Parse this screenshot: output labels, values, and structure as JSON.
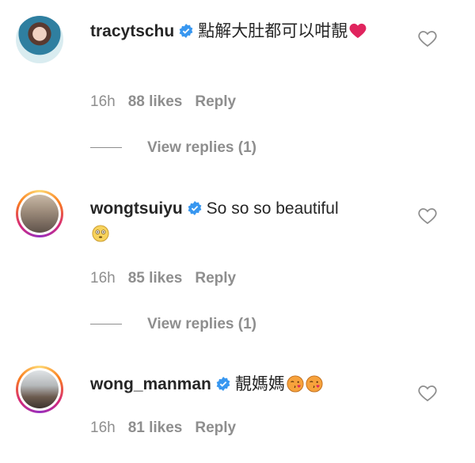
{
  "comments": [
    {
      "username": "tracytschu",
      "verified": true,
      "text": "點解大肚都可以咁靚",
      "emoji": "red-heart",
      "time": "16h",
      "likes": "88 likes",
      "reply": "Reply",
      "view_replies": "View replies (1)"
    },
    {
      "username": "wongtsuiyu",
      "verified": true,
      "text": "So so so beautiful",
      "emoji": "flushed-face",
      "time": "16h",
      "likes": "85 likes",
      "reply": "Reply",
      "view_replies": "View replies (1)"
    },
    {
      "username": "wong_manman",
      "verified": true,
      "text": "靚媽媽",
      "emoji": "face-blowing-kiss",
      "time": "16h",
      "likes": "81 likes",
      "reply": "Reply"
    }
  ],
  "icons": {
    "verified": "verified-badge-icon",
    "like": "heart-outline-icon"
  },
  "colors": {
    "verified": "#3897f0",
    "secondary_text": "#8e8e8e",
    "primary_text": "#262626",
    "heart_emoji": "#e0245e"
  }
}
